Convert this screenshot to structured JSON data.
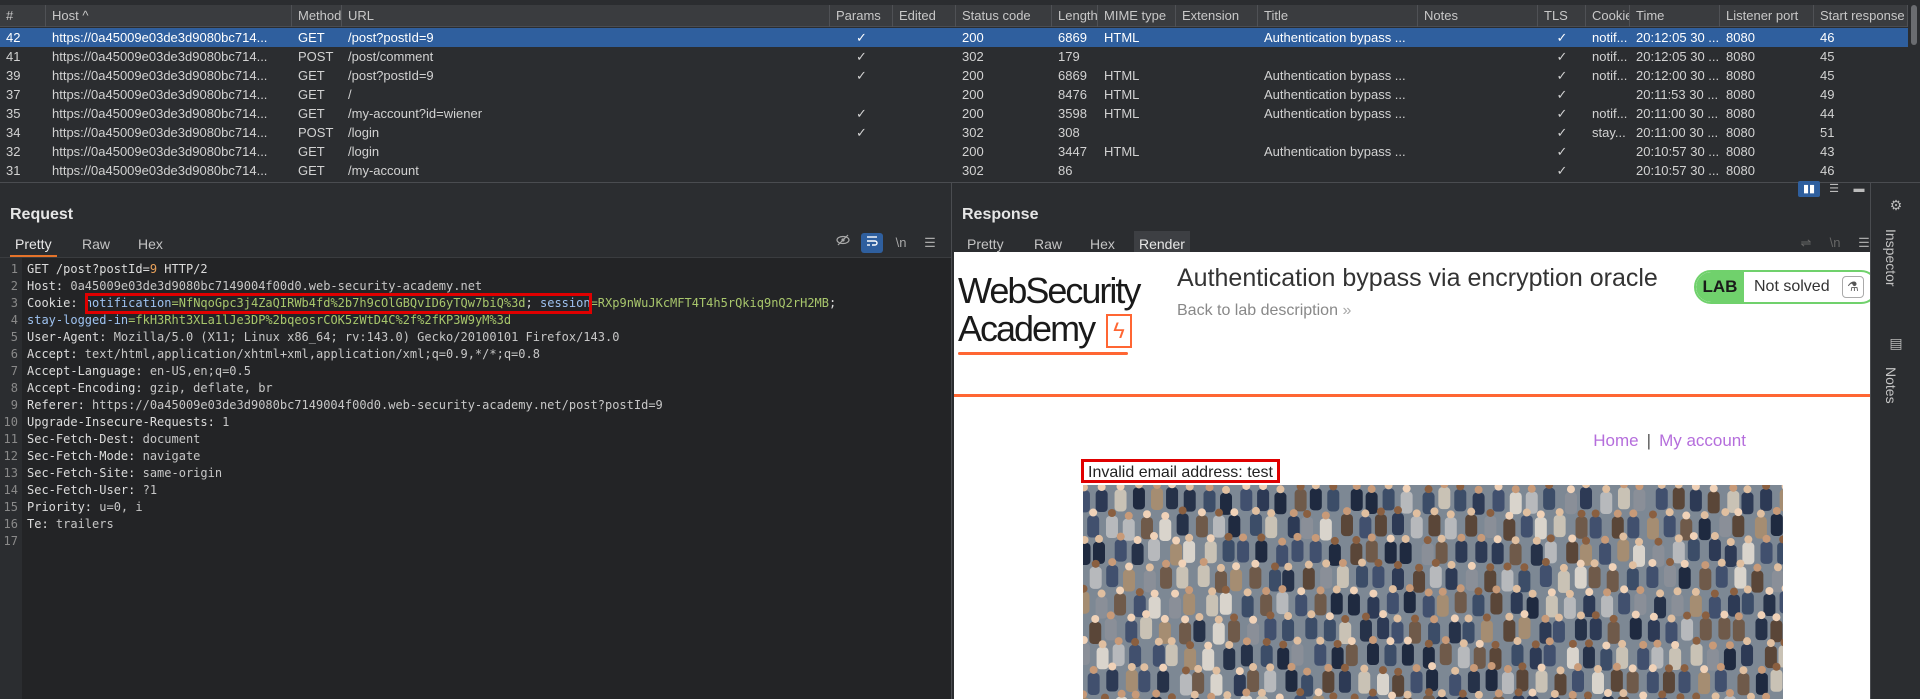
{
  "history": {
    "columns": [
      "#",
      "Host ^",
      "Method",
      "URL",
      "Params",
      "Edited",
      "Status code",
      "Length",
      "MIME type",
      "Extension",
      "Title",
      "Notes",
      "TLS",
      "Cookie",
      "Time",
      "Listener port",
      "Start response"
    ],
    "rows": [
      {
        "num": "42",
        "host": "https://0a45009e03de3d9080bc714...",
        "method": "GET",
        "url": "/post?postId=9",
        "params": "✓",
        "status": "200",
        "length": "6869",
        "mime": "HTML",
        "title": "Authentication bypass ...",
        "tls": "✓",
        "cookie": "notif...",
        "time": "20:12:05 30 ...",
        "port": "8080",
        "start": "46",
        "selected": true
      },
      {
        "num": "41",
        "host": "https://0a45009e03de3d9080bc714...",
        "method": "POST",
        "url": "/post/comment",
        "params": "✓",
        "status": "302",
        "length": "179",
        "mime": "",
        "title": "",
        "tls": "✓",
        "cookie": "notif...",
        "time": "20:12:05 30 ...",
        "port": "8080",
        "start": "45",
        "selected": false
      },
      {
        "num": "39",
        "host": "https://0a45009e03de3d9080bc714...",
        "method": "GET",
        "url": "/post?postId=9",
        "params": "✓",
        "status": "200",
        "length": "6869",
        "mime": "HTML",
        "title": "Authentication bypass ...",
        "tls": "✓",
        "cookie": "notif...",
        "time": "20:12:00 30 ...",
        "port": "8080",
        "start": "45",
        "selected": false
      },
      {
        "num": "37",
        "host": "https://0a45009e03de3d9080bc714...",
        "method": "GET",
        "url": "/",
        "params": "",
        "status": "200",
        "length": "8476",
        "mime": "HTML",
        "title": "Authentication bypass ...",
        "tls": "✓",
        "cookie": "",
        "time": "20:11:53 30 ...",
        "port": "8080",
        "start": "49",
        "selected": false
      },
      {
        "num": "35",
        "host": "https://0a45009e03de3d9080bc714...",
        "method": "GET",
        "url": "/my-account?id=wiener",
        "params": "✓",
        "status": "200",
        "length": "3598",
        "mime": "HTML",
        "title": "Authentication bypass ...",
        "tls": "✓",
        "cookie": "notif...",
        "time": "20:11:00 30 ...",
        "port": "8080",
        "start": "44",
        "selected": false
      },
      {
        "num": "34",
        "host": "https://0a45009e03de3d9080bc714...",
        "method": "POST",
        "url": "/login",
        "params": "✓",
        "status": "302",
        "length": "308",
        "mime": "",
        "title": "",
        "tls": "✓",
        "cookie": "stay...",
        "time": "20:11:00 30 ...",
        "port": "8080",
        "start": "51",
        "selected": false
      },
      {
        "num": "32",
        "host": "https://0a45009e03de3d9080bc714...",
        "method": "GET",
        "url": "/login",
        "params": "",
        "status": "200",
        "length": "3447",
        "mime": "HTML",
        "title": "Authentication bypass ...",
        "tls": "✓",
        "cookie": "",
        "time": "20:10:57 30 ...",
        "port": "8080",
        "start": "43",
        "selected": false
      },
      {
        "num": "31",
        "host": "https://0a45009e03de3d9080bc714...",
        "method": "GET",
        "url": "/my-account",
        "params": "",
        "status": "302",
        "length": "86",
        "mime": "",
        "title": "",
        "tls": "✓",
        "cookie": "",
        "time": "20:10:57 30 ...",
        "port": "8080",
        "start": "46",
        "selected": false
      }
    ]
  },
  "request": {
    "title": "Request",
    "tabs": [
      "Pretty",
      "Raw",
      "Hex"
    ],
    "active_tab": "Pretty",
    "tool_icons": [
      "hide-icon",
      "wrap-icon",
      "newline-icon",
      "menu-icon"
    ],
    "newline_label": "\\n",
    "line_numbers": [
      "1",
      "2",
      "3",
      "4",
      "5",
      "6",
      "7",
      "8",
      "9",
      "10",
      "11",
      "12",
      "13",
      "14",
      "15",
      "16",
      "17"
    ],
    "lines": {
      "l1_method_path": "GET /post?postId=",
      "l1_param": "9",
      "l1_proto": " HTTP/2",
      "host_key": "Host:",
      "host_val": " 0a45009e03de3d9080bc7149004f00d0.web-security-academy.net",
      "cookie_key": "Cookie:",
      "notif_key": "notification",
      "notif_val": "=NfNqoGpc3j4ZaQIRWb4fd%2b7h9cOlGBQvID6yTQw7biQ%3d",
      "semi": ";",
      "session_key": "session",
      "session_val": "=RXp9nWuJKcMFT4T4h5rQkiq9nQ2rH2MB",
      "semi2": ";",
      "stay_key": "stay-logged-in",
      "stay_val": "=fkH3Rht3XLa1lJe3DP%2bqeosrCOK5zWtD4C%2f%2fKP3W9yM%3d",
      "ua_key": "User-Agent:",
      "ua_val": " Mozilla/5.0 (X11; Linux x86_64; rv:143.0) Gecko/20100101 Firefox/143.0",
      "accept_key": "Accept:",
      "accept_val": " text/html,application/xhtml+xml,application/xml;q=0.9,*/*;q=0.8",
      "al_key": "Accept-Language:",
      "al_val": " en-US,en;q=0.5",
      "ae_key": "Accept-Encoding:",
      "ae_val": " gzip, deflate, br",
      "ref_key": "Referer:",
      "ref_val": " https://0a45009e03de3d9080bc7149004f00d0.web-security-academy.net/post?postId=9",
      "uir_key": "Upgrade-Insecure-Requests:",
      "uir_val": " 1",
      "sfd_key": "Sec-Fetch-Dest:",
      "sfd_val": " document",
      "sfm_key": "Sec-Fetch-Mode:",
      "sfm_val": " navigate",
      "sfs_key": "Sec-Fetch-Site:",
      "sfs_val": " same-origin",
      "sfu_key": "Sec-Fetch-User:",
      "sfu_val": " ?1",
      "pri_key": "Priority:",
      "pri_val": " u=0, i",
      "te_key": "Te:",
      "te_val": " trailers"
    }
  },
  "response": {
    "title": "Response",
    "tabs": [
      "Pretty",
      "Raw",
      "Hex",
      "Render"
    ],
    "active_tab": "Render",
    "render": {
      "logo_line1": "WebSecurity",
      "logo_line2": "Academy",
      "logo_bolt": "ϟ",
      "lab_title": "Authentication bypass via encryption oracle",
      "back_link": "Back to lab description",
      "back_chevron": "»",
      "badge_lab": "LAB",
      "badge_status": "Not solved",
      "badge_icon": "⚗",
      "nav_home": "Home",
      "nav_sep": "|",
      "nav_account": "My account",
      "error_text": "Invalid email address: test"
    }
  },
  "sidebar": {
    "inspector_label": "Inspector",
    "notes_label": "Notes"
  },
  "colors": {
    "selected_row": "#2f5f9e",
    "accent_orange": "#e5732a",
    "highlight_red": "#e00000",
    "lab_green": "#70d16c",
    "link_purple": "#b56edc"
  }
}
